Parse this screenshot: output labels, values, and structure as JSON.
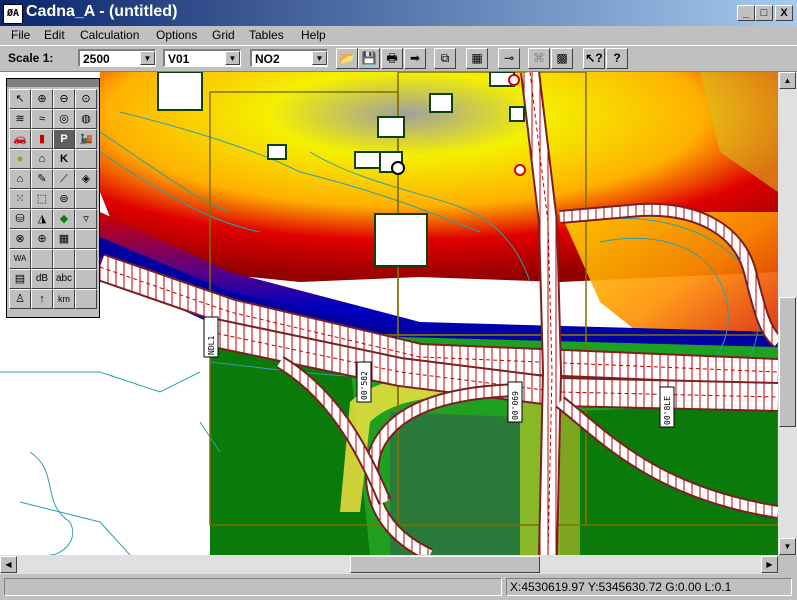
{
  "window": {
    "app_icon_text": "ØA",
    "title": "Cadna_A - (untitled)",
    "minimize": "_",
    "maximize": "□",
    "close": "X"
  },
  "menu": [
    "File",
    "Edit",
    "Calculation",
    "Options",
    "Grid",
    "Tables",
    "Help"
  ],
  "toolbar": {
    "scale_label": "Scale 1:",
    "scale_value": "2500",
    "variant_value": "V01",
    "pollutant_value": "NO2",
    "icons": [
      "open-icon",
      "save-icon",
      "print-icon",
      "arrow-right-icon",
      "copy-icon",
      "calculator-icon",
      "pin-icon",
      "disabled-objects-icon",
      "grid-icon",
      "help-pointer-icon",
      "help-icon"
    ]
  },
  "palette": {
    "icons": [
      "pointer-icon",
      "zoom-in-icon",
      "zoom-out-icon",
      "zoom-fit-icon",
      "road-icon",
      "railway-icon",
      "radar-icon",
      "tram-icon",
      "car-icon",
      "traffic-light-icon",
      "parking-icon",
      "train-icon",
      "circle-source-icon",
      "building-icon",
      "k-icon",
      "empty",
      "house-icon",
      "pen-icon",
      "line-icon",
      "reflector-icon",
      "points-icon",
      "area-source-icon",
      "circle-area-icon",
      "empty",
      "cylinder-icon",
      "terrain-icon",
      "green-area-icon",
      "triangle-icon",
      "target-icon",
      "globe-icon",
      "grid-area-icon",
      "empty",
      "dwa-icon",
      "empty",
      "empty",
      "empty",
      "chart-icon",
      "db-label-icon",
      "abc-text-icon",
      "empty",
      "figure-icon",
      "arrow-up-icon",
      "km-label-icon",
      "empty"
    ],
    "text_icons": {
      "parking": "P",
      "k": "K",
      "db": "dB",
      "abc": "abc",
      "km": "km",
      "wa": "WA"
    }
  },
  "road_labels": [
    "NDL1",
    "00'582",
    "00'069",
    "00'8LE"
  ],
  "status": {
    "coordinates": "X:4530619.97 Y:5345630.72 G:0.00 L:0.1"
  }
}
